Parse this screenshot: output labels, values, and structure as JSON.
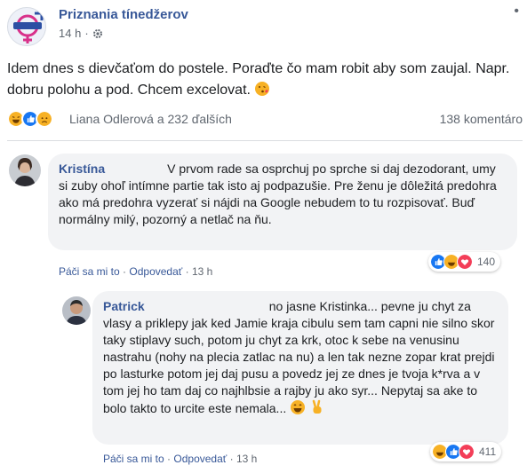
{
  "post": {
    "page_name": "Priznania tínedžerov",
    "time": "14 h",
    "text": "Idem dnes s dievčaťom do postele. Poraďte čo mam robit aby som zaujal. Napr. dobru polohu a pod. Chcem excelovat.",
    "reactors": "Liana Odlerová a 232 ďalších",
    "comment_count": "138 komentáro"
  },
  "comments": [
    {
      "author": "Kristína",
      "text": "V prvom rade sa osprchuj po sprche si daj dezodorant, umy si zuby ohoľ intímne partie tak isto aj podpazušie. Pre ženu je dôležitá predohra ako má predohra vyzerať si nájdi na Google nebudem to tu rozpisovať. Buď normálny milý, pozorný a netlač na ňu.",
      "like_label": "Páči sa mi to",
      "reply_label": "Odpovedať",
      "time": "13 h",
      "reaction_count": "140"
    },
    {
      "author": "Patrick",
      "text": "no jasne Kristinka... pevne ju chyt za vlasy a priklepy jak ked Jamie kraja cibulu sem tam capni nie silno skor taky stiplavy such, potom ju chyt za krk, otoc k sebe na venusinu nastrahu (nohy na plecia zatlac na nu) a len tak nezne zopar krat prejdi po lasturke potom jej daj pusu a povedz jej ze dnes je tvoja k*rva a v tom jej ho tam daj co najhlbsie a rajby ju ako syr... Nepytaj sa ake to bolo takto to urcite este nemala...",
      "like_label": "Páči sa mi to",
      "reply_label": "Odpovedať",
      "time": "13 h",
      "reaction_count": "411"
    }
  ],
  "colors": {
    "link_blue": "#385898",
    "like_blue": "#1877f2",
    "love_red": "#f33e58",
    "haha_yellow": "#f7b125",
    "bubble_bg": "#f2f3f5"
  }
}
